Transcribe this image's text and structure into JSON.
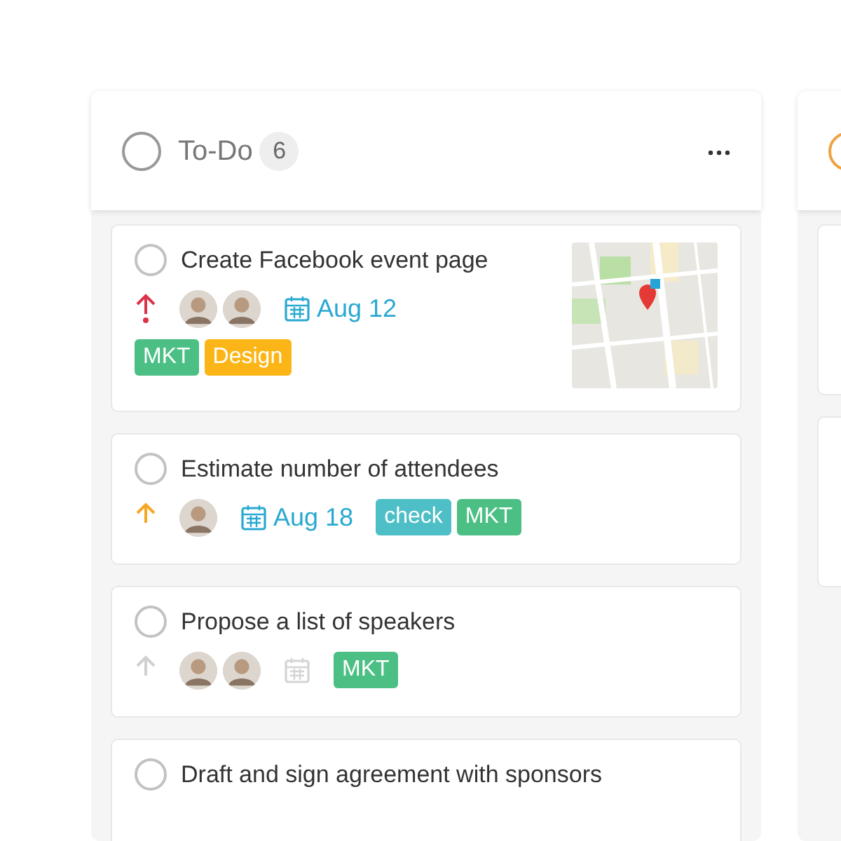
{
  "columns": [
    {
      "title": "To-Do",
      "count": "6",
      "color": "#999999",
      "tasks": [
        {
          "checked": false,
          "title": "Create Facebook event page",
          "priority": {
            "kind": "high"
          },
          "assignees": [
            {
              "kind": "avatar"
            },
            {
              "kind": "avatar"
            }
          ],
          "date": "Aug 12",
          "tags": [
            {
              "label": "MKT",
              "color": "#4cbf85"
            },
            {
              "label": "Design",
              "color": "#fbb516"
            }
          ]
        },
        {
          "checked": false,
          "title": "Estimate number of attendees",
          "priority": {
            "kind": "medium"
          },
          "assignees": [
            {
              "kind": "avatar"
            }
          ],
          "date": "Aug 18",
          "tags": [
            {
              "label": "check",
              "color": "#4ebfc6"
            },
            {
              "label": "MKT",
              "color": "#4cbf85"
            }
          ]
        },
        {
          "checked": false,
          "title": "Propose a list of speakers",
          "priority": {
            "kind": "none"
          },
          "assignees": [
            {
              "kind": "avatar"
            },
            {
              "kind": "avatar"
            }
          ],
          "tags": [
            {
              "label": "MKT",
              "color": "#4cbf85"
            }
          ]
        },
        {
          "checked": false,
          "title": "Draft and sign agreement with sponsors"
        }
      ]
    },
    {
      "color": "#f0a040",
      "tasks": [
        {
          "kind": "blank"
        },
        {
          "kind": "blank"
        }
      ]
    }
  ]
}
